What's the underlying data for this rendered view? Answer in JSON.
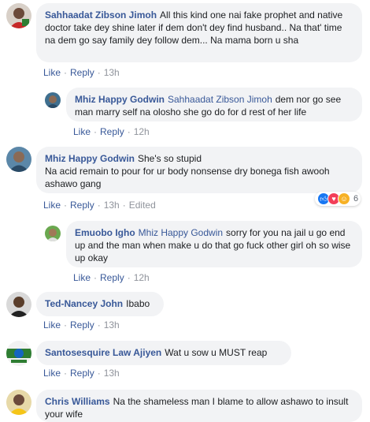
{
  "actions": {
    "like": "Like",
    "reply": "Reply",
    "separator": "·"
  },
  "comments": [
    {
      "author": "Sahhaadat Zibson Jimoh",
      "text": "All this kind one nai fake prophet and native doctor take dey shine later if dem don't dey find husband.. Na that' time na dem go say family dey follow dem... Na mama born u sha",
      "time": "13h"
    },
    {
      "author": "Mhiz Happy Godwin",
      "tag": "Sahhaadat Zibson Jimoh",
      "text": "dem nor go see man marry self na olosho she go do for d rest of her life",
      "time": "12h"
    },
    {
      "author": "Mhiz Happy Godwin",
      "text": "She's so stupid",
      "text2": "Na acid remain to pour for ur body nonsense dry bonega fish awooh ashawo gang",
      "time": "13h",
      "edited": "Edited",
      "reaction_count": "6",
      "reactions": [
        "like-reaction-icon",
        "love-reaction-icon",
        "haha-reaction-icon"
      ]
    },
    {
      "author": "Emuobo Igho",
      "tag": "Mhiz Happy Godwin",
      "text": "sorry for you na jail u go end up and the man when make u do that go fuck other girl oh so wise up okay",
      "time": "12h"
    },
    {
      "author": "Ted-Nancey John",
      "text": "Ibabo",
      "time": "13h"
    },
    {
      "author": "Santosesquire Law Ajiyen",
      "text": "Wat u sow u MUST reap",
      "time": "13h"
    },
    {
      "author": "Chris Williams",
      "text": "Na the shameless man I blame to allow ashawo to insult your wife"
    }
  ],
  "colors": {
    "link": "#385898",
    "bubble": "#f2f3f5",
    "meta": "#90949c",
    "like_reaction": "#1877f2",
    "love_reaction": "#f33e58",
    "haha_reaction": "#f7b125"
  }
}
